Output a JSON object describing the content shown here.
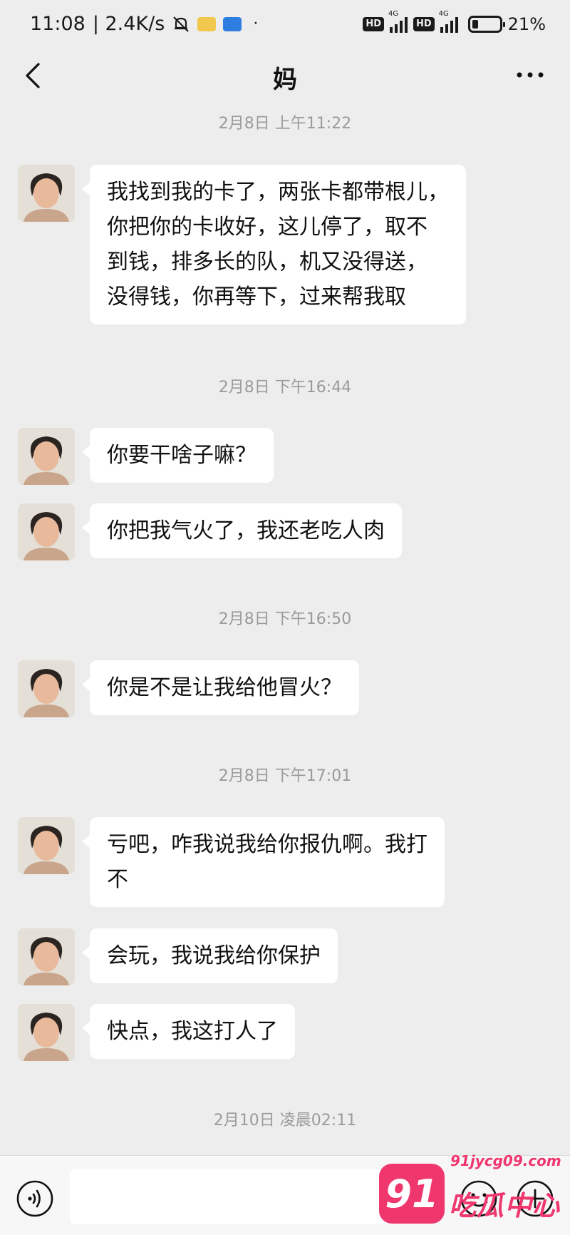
{
  "status_bar": {
    "time": "11:08",
    "network_speed": "| 2.4K/s",
    "dot": "·",
    "hd_1": "HD",
    "net_1": "4G",
    "hd_2": "HD",
    "net_2": "4G",
    "battery": "21%",
    "battery_level": 0.21,
    "icons": [
      "bell-muted-icon",
      "notification-yellow-icon",
      "notification-blue-icon",
      "signal-icon",
      "battery-icon"
    ]
  },
  "header": {
    "title": "妈",
    "back_icon": "chevron-left-icon",
    "more_icon": "more-dots-icon"
  },
  "chat": {
    "timestamps": [
      "2月8日 上午11:22",
      "2月8日 下午16:44",
      "2月8日 下午16:50",
      "2月8日 下午17:01",
      "2月10日 凌晨02:11"
    ],
    "messages": [
      {
        "lines": [
          "我找到我的卡了，两张卡都带根儿，",
          "你把你的卡收好，这儿停了，取不",
          "到钱，排多长的队，机又没得送，",
          "没得钱，你再等下，过来帮我取"
        ]
      },
      {
        "lines": [
          "你要干啥子嘛？"
        ]
      },
      {
        "lines": [
          "你把我气火了，我还老吃人肉"
        ]
      },
      {
        "lines": [
          "你是不是让我给他冒火？"
        ]
      },
      {
        "lines": [
          "亏吧，咋我说我给你报仇啊。我打",
          "不"
        ]
      },
      {
        "lines": [
          "会玩，我说我给你保护"
        ]
      },
      {
        "lines": [
          "快点，我这打人了"
        ]
      }
    ]
  },
  "input_bar": {
    "value": "",
    "voice_icon": "voice-icon",
    "emoji_icon": "emoji-icon",
    "plus_icon": "plus-icon"
  },
  "watermark": {
    "badge": "91",
    "url": "91jycg09.com",
    "name": "吃瓜中心",
    "color": "#f0376d"
  }
}
